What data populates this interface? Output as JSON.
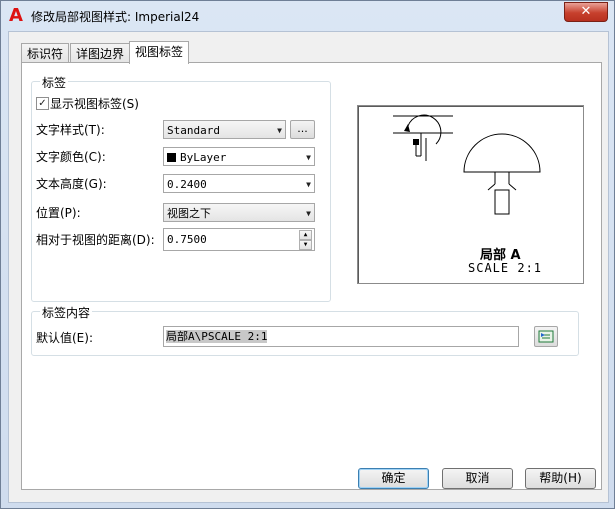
{
  "window": {
    "title": "修改局部视图样式: Imperial24",
    "app_icon_glyph": "A",
    "close_glyph": "✕"
  },
  "tabs": [
    {
      "label": "标识符",
      "active": false
    },
    {
      "label": "详图边界",
      "active": false
    },
    {
      "label": "视图标签",
      "active": true
    }
  ],
  "label_group": {
    "title": "标签",
    "show_label": {
      "label": "显示视图标签(S)",
      "checked": true
    },
    "text_style": {
      "label": "文字样式(T):",
      "value": "Standard",
      "browse_label": "..."
    },
    "text_color": {
      "label": "文字颜色(C):",
      "value": "ByLayer",
      "swatch_color": "#000000"
    },
    "text_height": {
      "label": "文本高度(G):",
      "value": "0.2400"
    },
    "position": {
      "label": "位置(P):",
      "value": "视图之下"
    },
    "distance": {
      "label": "相对于视图的距离(D):",
      "value": "0.7500"
    }
  },
  "preview": {
    "caption_title": "局部 A",
    "caption_scale": "SCALE 2:1"
  },
  "content_group": {
    "title": "标签内容",
    "default_label": "默认值(E):",
    "default_value_bold": "局部",
    "default_value_rest": "A\\PSCALE 2:1",
    "field_button_icon": "insert-field-icon"
  },
  "buttons": {
    "ok": "确定",
    "cancel": "取消",
    "help": "帮助(H)"
  },
  "colors": {
    "accent_red": "#d11111",
    "default_button_border": "#3c7fb1"
  }
}
